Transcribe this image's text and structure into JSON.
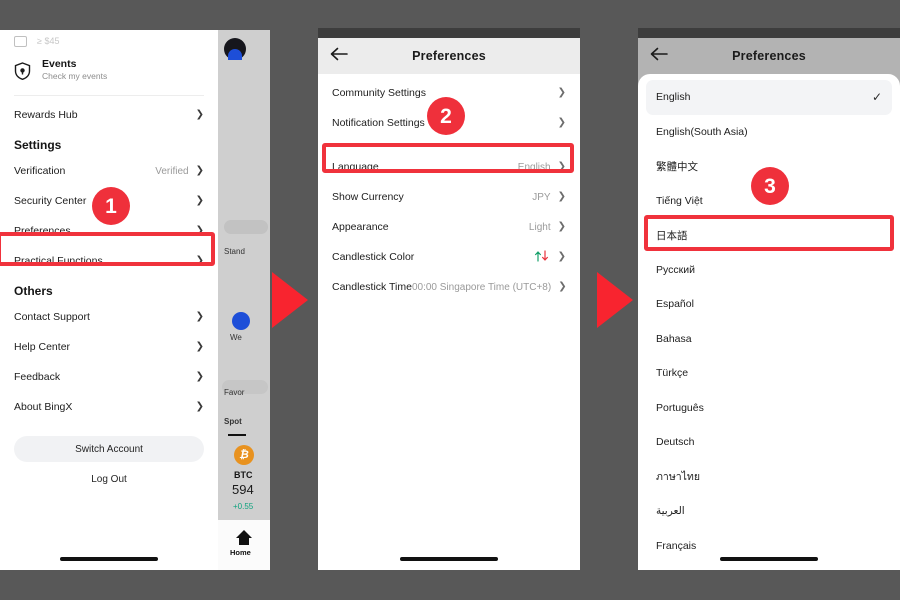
{
  "background_color": "#585858",
  "accent_red": "#f0323c",
  "panel1": {
    "name": "settings-drawer",
    "clipped_row": {
      "text": "≥ $45"
    },
    "events": {
      "title": "Events",
      "subtitle": "Check my events",
      "icon": "shield-icon"
    },
    "rewards": {
      "label": "Rewards Hub"
    },
    "settings_section": {
      "title": "Settings"
    },
    "items": [
      {
        "label": "Verification",
        "value": "Verified"
      },
      {
        "label": "Security Center",
        "value": ""
      },
      {
        "label": "Preferences",
        "value": ""
      },
      {
        "label": "Practical Functions",
        "value": ""
      }
    ],
    "others_section": {
      "title": "Others"
    },
    "others": [
      {
        "label": "Contact Support"
      },
      {
        "label": "Help Center"
      },
      {
        "label": "Feedback"
      },
      {
        "label": "About BingX"
      }
    ],
    "switch_account": "Switch Account",
    "log_out": "Log Out"
  },
  "background_app": {
    "standard_label": "Stand",
    "web_label": "We",
    "favorites_label": "Favor",
    "spot_label": "Spot",
    "btc_symbol": "BTC",
    "btc_icon": "bitcoin-icon",
    "btc_price": "594",
    "btc_change": "+0.55",
    "home_tab": "Home"
  },
  "panel2": {
    "name": "preferences-screen",
    "header_title": "Preferences",
    "back_icon": "back-arrow-icon",
    "rows": [
      {
        "label": "Community Settings",
        "value": ""
      },
      {
        "label": "Notification Settings",
        "value": ""
      },
      {
        "label": "Language",
        "value": "English"
      },
      {
        "label": "Show Currency",
        "value": "JPY"
      },
      {
        "label": "Appearance",
        "value": "Light"
      },
      {
        "label": "Candlestick Color",
        "value": "",
        "icon": "candlestick-arrows-icon"
      },
      {
        "label": "Candlestick Time",
        "value": "00:00 Singapore Time (UTC+8)"
      }
    ]
  },
  "panel3": {
    "name": "language-picker-sheet",
    "header_title": "Preferences",
    "back_icon": "back-arrow-icon",
    "selected_language": "English",
    "check_icon": "check-icon",
    "languages": [
      "English",
      "English(South Asia)",
      "繁體中文",
      "Tiếng Việt",
      "日本語",
      "Русский",
      "Español",
      "Bahasa",
      "Türkçe",
      "Português",
      "Deutsch",
      "ภาษาไทย",
      "العربية",
      "Français"
    ]
  },
  "annotations": {
    "badges": [
      {
        "number": "1"
      },
      {
        "number": "2"
      },
      {
        "number": "3"
      }
    ],
    "highlight_targets": [
      "Preferences",
      "Language",
      "日本語"
    ],
    "arrows": 2
  }
}
